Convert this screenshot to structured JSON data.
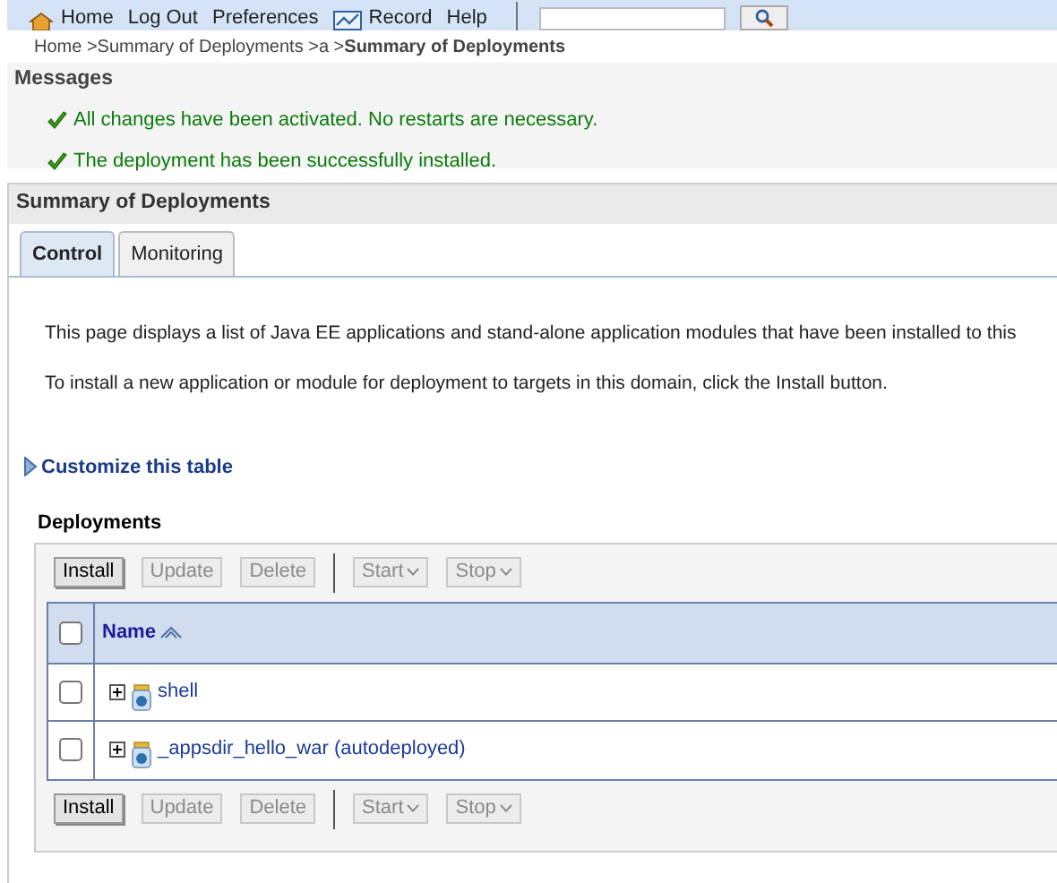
{
  "top_bar": {
    "links": [
      {
        "label": "Home",
        "kind": "home"
      },
      {
        "label": "Log Out",
        "kind": "plain"
      },
      {
        "label": "Preferences",
        "kind": "plain"
      },
      {
        "label": "Record",
        "kind": "record"
      },
      {
        "label": "Help",
        "kind": "plain"
      }
    ]
  },
  "breadcrumb": {
    "items": [
      "Home >",
      "Summary of Deployments >",
      "a >"
    ],
    "current": "Summary of Deployments"
  },
  "messages": {
    "title": "Messages",
    "items": [
      "All changes have been activated. No restarts are necessary.",
      "The deployment has been successfully installed."
    ]
  },
  "summary": {
    "title": "Summary of Deployments",
    "tabs": [
      {
        "label": "Control",
        "selected": true
      },
      {
        "label": "Monitoring",
        "selected": false
      }
    ],
    "paragraphs": [
      "This page displays a list of Java EE applications and stand-alone application modules that have been installed to this",
      "To install a new application or module for deployment to targets in this domain, click the Install button."
    ],
    "customize_link": "Customize this table",
    "deployments": {
      "title": "Deployments",
      "toolbar_top": [
        {
          "label": "Install",
          "kind": "button",
          "disabled": false
        },
        {
          "label": "Update",
          "kind": "button",
          "disabled": true
        },
        {
          "label": "Delete",
          "kind": "button",
          "disabled": true
        },
        {
          "label": "Start",
          "kind": "menu",
          "disabled": true
        },
        {
          "label": "Stop",
          "kind": "menu",
          "disabled": true
        }
      ],
      "columns": [
        {
          "label": "Name",
          "checked": false
        }
      ],
      "rows": [
        {
          "name": "shell",
          "checked": false
        },
        {
          "name": "_appsdir_hello_war (autodeployed)",
          "checked": false
        }
      ],
      "toolbar_bottom": [
        {
          "label": "Install",
          "kind": "button",
          "disabled": false
        },
        {
          "label": "Update",
          "kind": "button",
          "disabled": true
        },
        {
          "label": "Delete",
          "kind": "button",
          "disabled": true
        },
        {
          "label": "Start",
          "kind": "menu",
          "disabled": true
        },
        {
          "label": "Stop",
          "kind": "menu",
          "disabled": true
        }
      ]
    }
  }
}
